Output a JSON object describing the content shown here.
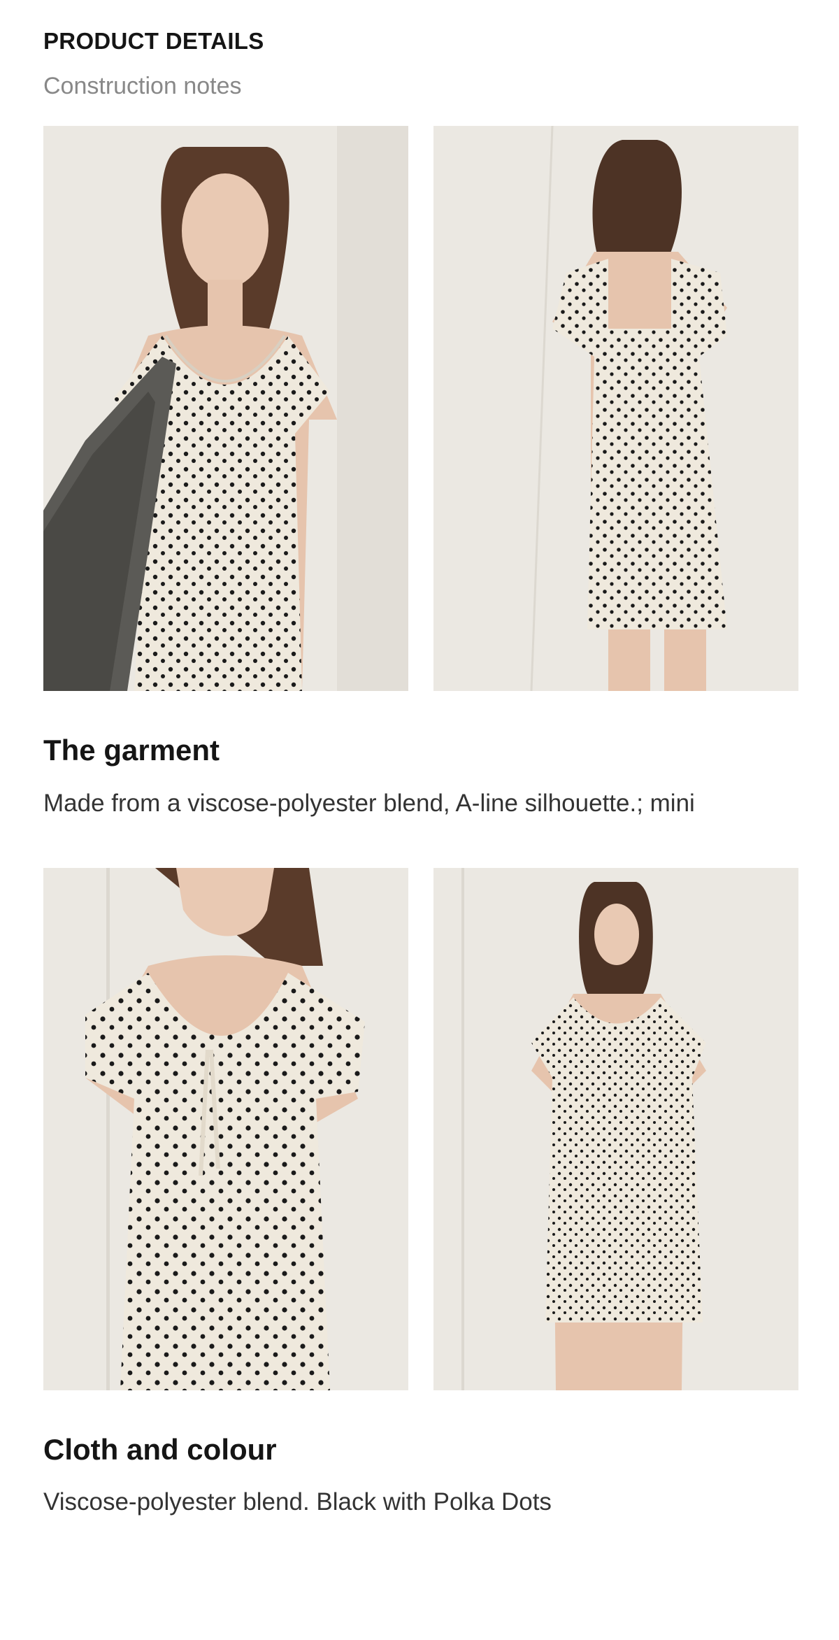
{
  "header": {
    "title": "PRODUCT DETAILS",
    "subtitle": "Construction notes"
  },
  "gallery": [
    {
      "alt": "Model front view holding woven tote bag, polka dot dress"
    },
    {
      "alt": "Model back view, polka dot dress"
    },
    {
      "alt": "Close-up of neckline with tie front and puff sleeves"
    },
    {
      "alt": "Model full-length front view"
    }
  ],
  "sections": [
    {
      "heading": "The garment",
      "body": "Made from a viscose-polyester blend, A-line silhouette.; mini"
    },
    {
      "heading": "Cloth and colour",
      "body": "Viscose-polyester blend. Black with Polka Dots"
    }
  ],
  "colors": {
    "background": "#ffffff",
    "heading": "#151515",
    "subtitle": "#888888",
    "body": "#333333",
    "dress": "#efe9dd",
    "dots": "#1a1a1a"
  }
}
